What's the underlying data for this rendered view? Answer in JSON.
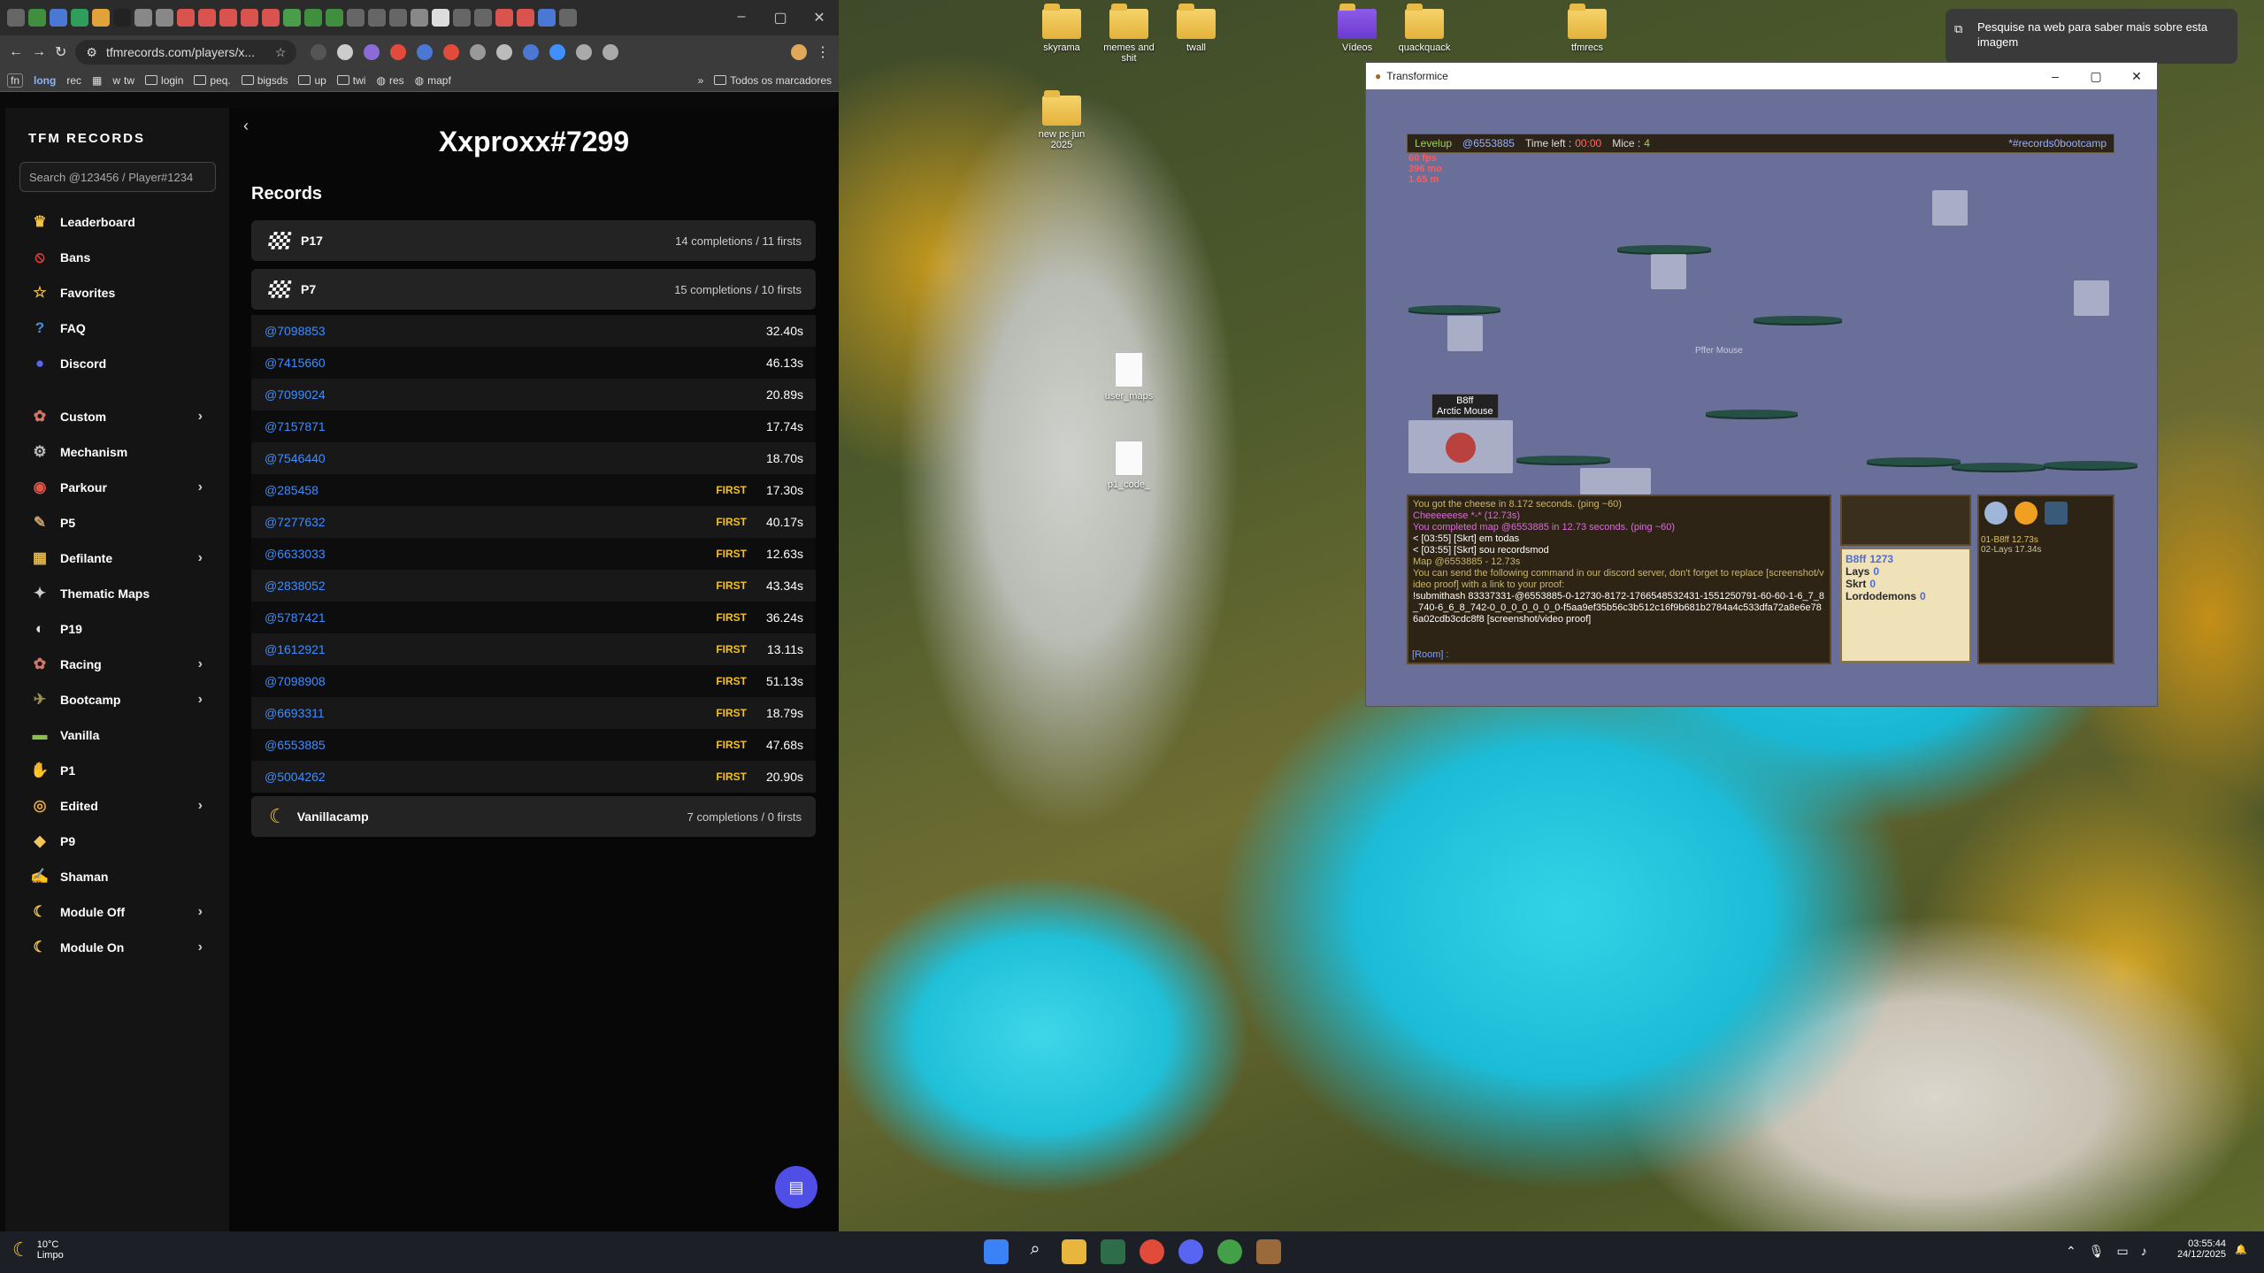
{
  "browser": {
    "url": "tfmrecords.com/players/x...",
    "window_controls": [
      "–",
      "▢",
      "✕"
    ],
    "bookmarks": [
      "fn",
      "long",
      "rec",
      "tw",
      "login",
      "peq.",
      "bigsds",
      "up",
      "twi",
      "res",
      "mapf",
      "Todos os marcadores"
    ]
  },
  "app": {
    "brand": "TFM RECORDS",
    "search_placeholder": "Search @123456 / Player#1234",
    "nav": [
      {
        "label": "Leaderboard",
        "icon": "crown-icon",
        "glyph": "♛",
        "color": "#f5c542",
        "sub": false
      },
      {
        "label": "Bans",
        "icon": "ban-icon",
        "glyph": "⦸",
        "color": "#e53935",
        "sub": false
      },
      {
        "label": "Favorites",
        "icon": "star-icon",
        "glyph": "☆",
        "color": "#f5c542",
        "sub": false
      },
      {
        "label": "FAQ",
        "icon": "help-icon",
        "glyph": "?",
        "color": "#4a90e2",
        "sub": false
      },
      {
        "label": "Discord",
        "icon": "discord-icon",
        "glyph": "●",
        "color": "#5865f2",
        "sub": false
      },
      {
        "label": "Custom",
        "icon": "mouse-icon",
        "glyph": "✿",
        "color": "#d4756b",
        "sub": true
      },
      {
        "label": "Mechanism",
        "icon": "gear-icon",
        "glyph": "⚙",
        "color": "#bbbbbb",
        "sub": false
      },
      {
        "label": "Parkour",
        "icon": "parkour-icon",
        "glyph": "◉",
        "color": "#e0554a",
        "sub": true
      },
      {
        "label": "P5",
        "icon": "brush-icon",
        "glyph": "✎",
        "color": "#c8a06a",
        "sub": false
      },
      {
        "label": "Defilante",
        "icon": "defilante-icon",
        "glyph": "▦",
        "color": "#e6b84a",
        "sub": true
      },
      {
        "label": "Thematic Maps",
        "icon": "thematic-icon",
        "glyph": "✦",
        "color": "#cfcfcf",
        "sub": false
      },
      {
        "label": "P19",
        "icon": "p19-icon",
        "glyph": "◐",
        "color": "#dddddd",
        "sub": false
      },
      {
        "label": "Racing",
        "icon": "racing-icon",
        "glyph": "✿",
        "color": "#d4756b",
        "sub": true
      },
      {
        "label": "Bootcamp",
        "icon": "bootcamp-icon",
        "glyph": "✈",
        "color": "#9c8f4a",
        "sub": true
      },
      {
        "label": "Vanilla",
        "icon": "vanilla-icon",
        "glyph": "▬",
        "color": "#8bbf4a",
        "sub": false
      },
      {
        "label": "P1",
        "icon": "p1-icon",
        "glyph": "✋",
        "color": "#f2c45a",
        "sub": false
      },
      {
        "label": "Edited",
        "icon": "edited-icon",
        "glyph": "◎",
        "color": "#e6a83a",
        "sub": true
      },
      {
        "label": "P9",
        "icon": "cheese-icon",
        "glyph": "◆",
        "color": "#f2c45a",
        "sub": false
      },
      {
        "label": "Shaman",
        "icon": "shaman-icon",
        "glyph": "✍",
        "color": "#9fd0e0",
        "sub": false
      },
      {
        "label": "Module Off",
        "icon": "moon-icon",
        "glyph": "☾",
        "color": "#f5c542",
        "sub": true
      },
      {
        "label": "Module On",
        "icon": "moon-icon",
        "glyph": "☾",
        "color": "#f5c542",
        "sub": true
      }
    ],
    "player_title": "Xxproxx#7299",
    "records_heading": "Records",
    "categories": [
      {
        "name": "P17",
        "stats": "14 completions / 11 firsts"
      },
      {
        "name": "P7",
        "stats": "15 completions / 10 firsts"
      },
      {
        "name": "Vanillacamp",
        "stats": "7 completions / 0 firsts"
      }
    ],
    "first_label": "FIRST",
    "records": [
      {
        "map": "@7098853",
        "first": false,
        "time": "32.40s"
      },
      {
        "map": "@7415660",
        "first": false,
        "time": "46.13s"
      },
      {
        "map": "@7099024",
        "first": false,
        "time": "20.89s"
      },
      {
        "map": "@7157871",
        "first": false,
        "time": "17.74s"
      },
      {
        "map": "@7546440",
        "first": false,
        "time": "18.70s"
      },
      {
        "map": "@285458",
        "first": true,
        "time": "17.30s"
      },
      {
        "map": "@7277632",
        "first": true,
        "time": "40.17s"
      },
      {
        "map": "@6633033",
        "first": true,
        "time": "12.63s"
      },
      {
        "map": "@2838052",
        "first": true,
        "time": "43.34s"
      },
      {
        "map": "@5787421",
        "first": true,
        "time": "36.24s"
      },
      {
        "map": "@1612921",
        "first": true,
        "time": "13.11s"
      },
      {
        "map": "@7098908",
        "first": true,
        "time": "51.13s"
      },
      {
        "map": "@6693311",
        "first": true,
        "time": "18.79s"
      },
      {
        "map": "@6553885",
        "first": true,
        "time": "47.68s"
      },
      {
        "map": "@5004262",
        "first": true,
        "time": "20.90s"
      }
    ]
  },
  "desktop": {
    "icons": [
      "skyrama",
      "memes and shit",
      "twall",
      "Vídeos",
      "quackquack",
      "tfmrecs",
      "new pc jun 2025",
      "user_maps",
      "p1_code_"
    ],
    "toast": "Pesquise na web para saber mais sobre esta imagem"
  },
  "game": {
    "window_title": "Transformice",
    "hud": {
      "level": "Levelup",
      "map": "@6553885",
      "time_label": "Time left :",
      "time": "00:00",
      "mice_label": "Mice :",
      "mice": "4",
      "channel": "*#records0bootcamp"
    },
    "stats": [
      "60 fps",
      "396 mo",
      "1.65 m"
    ],
    "player_name": "B8ff",
    "player_title": "Arctic Mouse",
    "ghost_name": "Pffer Mouse",
    "chat": [
      "You got the cheese in 8.172 seconds. (ping ~60)",
      "Cheeeeeese *-* (12.73s)",
      "You completed map @6553885 in 12.73 seconds. (ping ~60)",
      "< [03:55] [Skrt] em todas",
      "< [03:55] [Skrt] sou recordsmod",
      "Map @6553885 - 12.73s",
      "You can send the following command in our discord server, don't forget to replace [screenshot/video proof] with a link to your proof:",
      "!submithash 83337331-@6553885-0-12730-8172-1766548532431-1551250791-60-60-1-6_7_8_740-6_6_8_742-0_0_0_0_0_0_0-f5aa9ef35b56c3b512c16f9b681b2784a4c533dfa72a8e6e786a02cdb3cdc8f8 [screenshot/video proof]"
    ],
    "chat_input": "[Room] :",
    "leaderboard": [
      {
        "name": "B8ff",
        "score": "1273"
      },
      {
        "name": "Lays",
        "score": "0"
      },
      {
        "name": "Skrt",
        "score": "0"
      },
      {
        "name": "Lordodemons",
        "score": "0"
      }
    ],
    "times": [
      "01-B8ff 12.73s",
      "02-Lays 17.34s"
    ]
  },
  "taskbar": {
    "weather_temp": "10°C",
    "weather_desc": "Limpo",
    "time": "03:55:44",
    "date": "24/12/2025"
  }
}
